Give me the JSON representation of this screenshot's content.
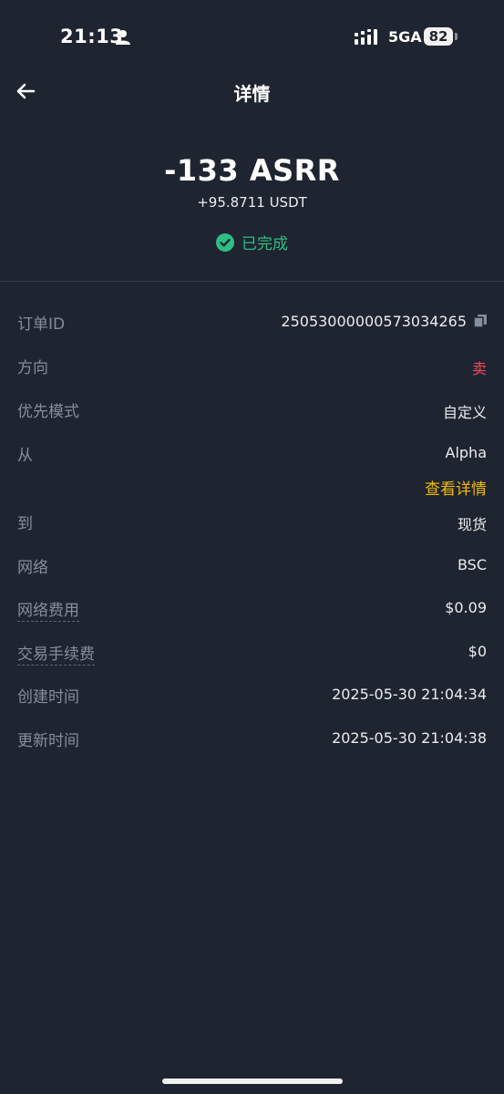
{
  "status_bar": {
    "time": "21:13",
    "network": "5GA",
    "battery": "82"
  },
  "nav": {
    "title": "详情"
  },
  "summary": {
    "amount": "-133 ASRR",
    "received": "+95.8711 USDT",
    "status": "已完成"
  },
  "details": [
    {
      "label": "订单ID",
      "value": "2505300000057303426​5"
    },
    {
      "label": "方向",
      "value": "卖"
    },
    {
      "label": "优先模式",
      "value": "自定义"
    },
    {
      "label": "从",
      "value": "Alpha"
    },
    {
      "label": "到",
      "value": "现货"
    },
    {
      "label": "网络",
      "value": "BSC"
    },
    {
      "label": "网络费用",
      "value": "$0.09"
    },
    {
      "label": "交易手续费",
      "value": "$0"
    },
    {
      "label": "创建时间",
      "value": "2025-05-30 21:04:34"
    },
    {
      "label": "更新时间",
      "value": "2025-05-30 21:04:38"
    }
  ],
  "view_details_link": "查看详情",
  "colors": {
    "background": "#1f2530",
    "success": "#2ebd85",
    "sell": "#f6465d",
    "accent": "#f0b90b",
    "label": "#848e9c"
  }
}
